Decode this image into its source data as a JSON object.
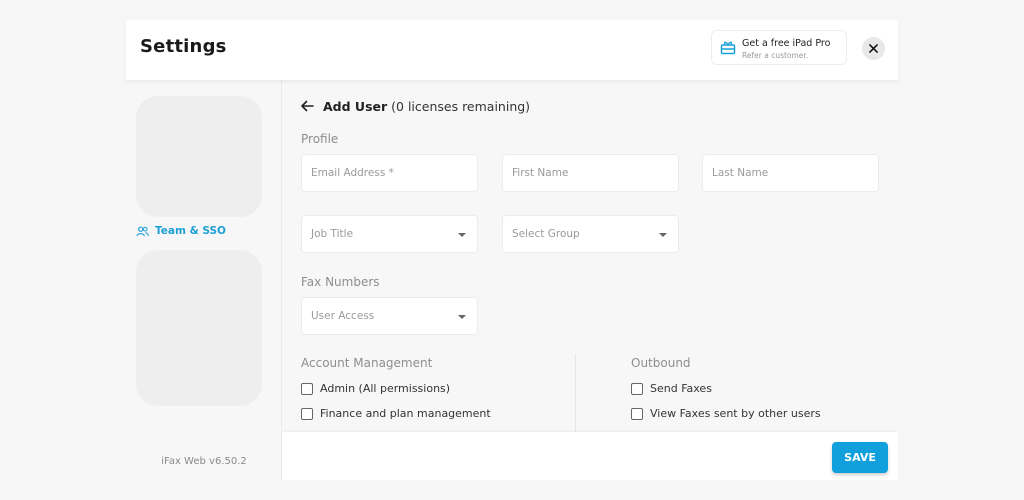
{
  "header": {
    "title": "Settings",
    "promo": {
      "title": "Get a free iPad Pro",
      "subtitle": "Refer a customer.",
      "icon": "gift-icon"
    },
    "close_icon": "close-icon"
  },
  "sidebar": {
    "items": [
      {
        "label": "Team & SSO",
        "icon": "users-icon",
        "active": true
      }
    ],
    "version": "iFax Web v6.50.2"
  },
  "main": {
    "heading": {
      "title": "Add User",
      "subtitle": "(0 licenses remaining)"
    },
    "profile": {
      "label": "Profile",
      "email": {
        "placeholder": "Email Address *",
        "value": ""
      },
      "first_name": {
        "placeholder": "First Name",
        "value": ""
      },
      "last_name": {
        "placeholder": "Last Name",
        "value": ""
      },
      "job_title": {
        "placeholder": "Job Title"
      },
      "group": {
        "placeholder": "Select Group"
      }
    },
    "fax_numbers": {
      "label": "Fax Numbers",
      "user_access": {
        "placeholder": "User Access"
      }
    },
    "account_management": {
      "label": "Account Management",
      "options": [
        {
          "label": "Admin (All permissions)",
          "checked": false
        },
        {
          "label": "Finance and plan management",
          "checked": false
        }
      ]
    },
    "outbound": {
      "label": "Outbound",
      "options": [
        {
          "label": "Send Faxes",
          "checked": false
        },
        {
          "label": "View Faxes sent by other users",
          "checked": false
        }
      ]
    }
  },
  "footer": {
    "save_label": "SAVE"
  },
  "colors": {
    "accent": "#12a0dc",
    "link": "#1c9fd6"
  }
}
